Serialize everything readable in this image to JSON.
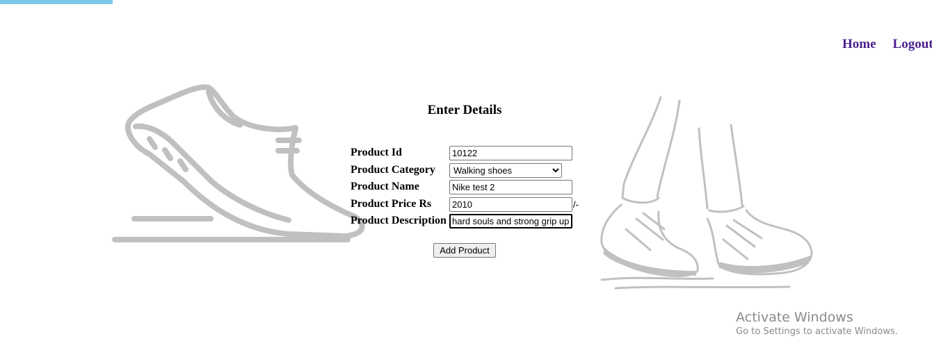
{
  "nav": {
    "home": "Home",
    "logout": "Logout"
  },
  "form": {
    "heading": "Enter Details",
    "product_id": {
      "label": "Product Id",
      "value": "10122"
    },
    "product_category": {
      "label": "Product Category",
      "value": "Walking shoes"
    },
    "product_name": {
      "label": "Product Name",
      "value": "Nike test 2"
    },
    "product_price": {
      "label": "Product Price Rs",
      "value": "2010",
      "suffix": "/-"
    },
    "product_description": {
      "label": "Product Description",
      "value": "hard souls and strong grip up"
    },
    "submit_label": "Add Product"
  },
  "watermark": {
    "title": "Activate Windows",
    "subtitle": "Go to Settings to activate Windows."
  },
  "colors": {
    "accent_bar": "#7cc8ea",
    "nav_link": "#4b1f8f",
    "illustration": "#c0c0c0"
  },
  "icons": [
    "running-shoe-illustration",
    "walking-feet-illustration"
  ]
}
